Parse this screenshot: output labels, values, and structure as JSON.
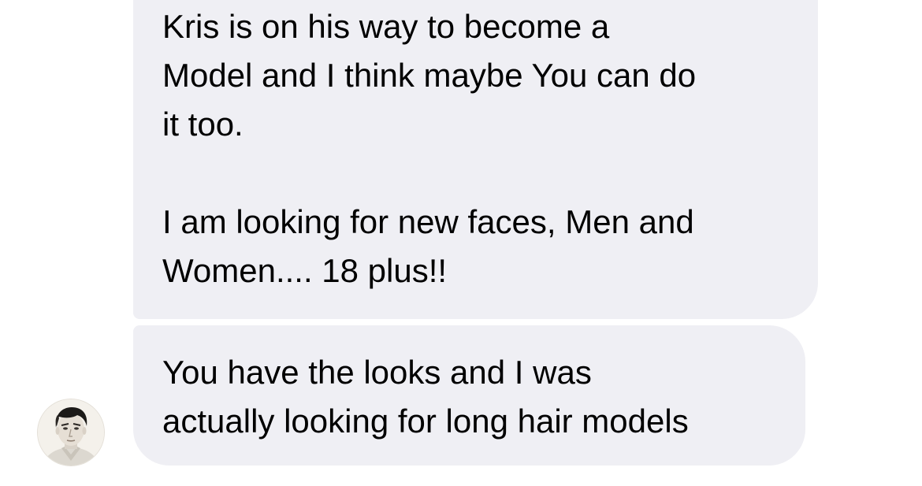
{
  "messages": [
    {
      "sender": "incoming",
      "paragraphs": [
        [
          "Kris is on his way to become a",
          "Model and I think maybe You can do",
          "it too."
        ],
        [
          "I am looking for new faces, Men and",
          "Women.... 18 plus!!"
        ]
      ]
    },
    {
      "sender": "incoming",
      "paragraphs": [
        [
          "You have the looks and I was",
          "actually looking for long hair models"
        ]
      ]
    }
  ],
  "colors": {
    "bubble_background": "#efeff4",
    "text": "#000000",
    "page_background": "#ffffff"
  },
  "avatar": {
    "icon": "man-portrait-avatar-icon"
  }
}
